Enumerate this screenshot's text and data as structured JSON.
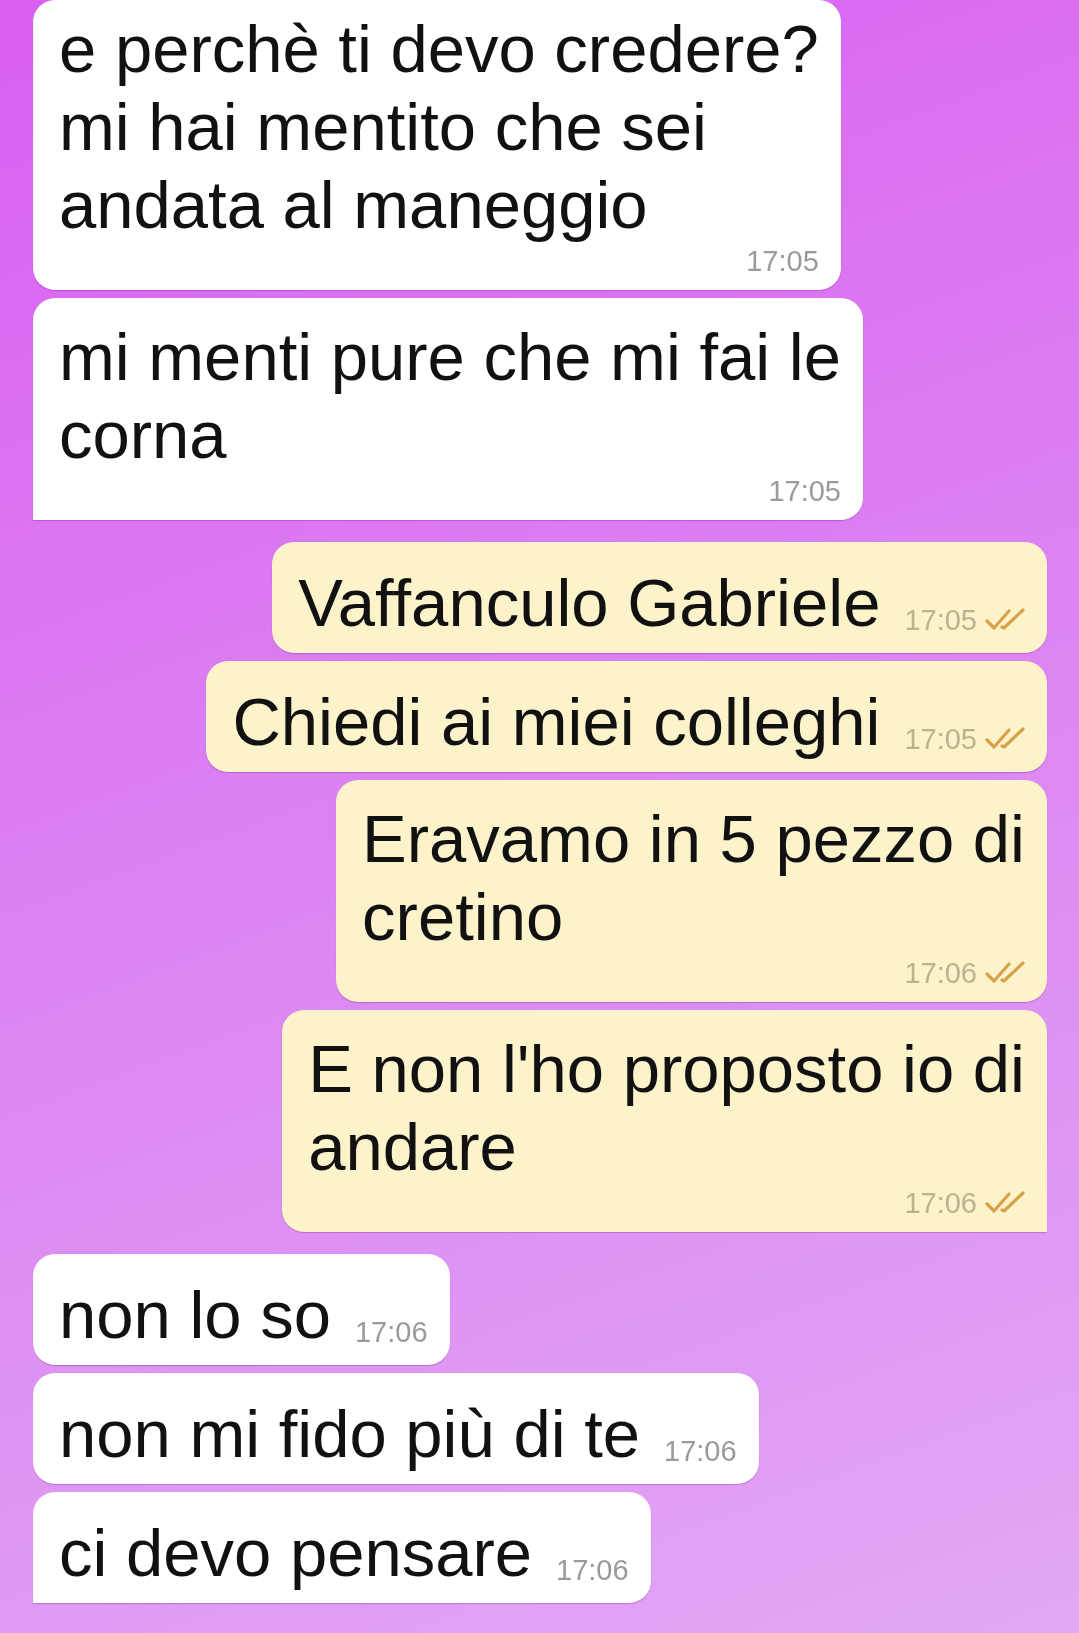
{
  "messages": [
    {
      "kind": "in",
      "lines": [
        "e perchè ti devo credere?",
        "mi hai mentito che sei",
        "andata al maneggio"
      ],
      "time": "17:05",
      "tail": false
    },
    {
      "kind": "in",
      "lines": [
        "mi menti pure che mi fai le",
        "corna"
      ],
      "time": "17:05",
      "tail": true
    },
    {
      "kind": "out",
      "lines": [
        "Vaffanculo Gabriele"
      ],
      "time": "17:05",
      "read": true,
      "tail": false
    },
    {
      "kind": "out",
      "lines": [
        "Chiedi ai miei colleghi"
      ],
      "time": "17:05",
      "read": true,
      "tail": false
    },
    {
      "kind": "out",
      "lines": [
        "Eravamo in 5 pezzo di",
        "cretino"
      ],
      "time": "17:06",
      "read": true,
      "tail": false
    },
    {
      "kind": "out",
      "lines": [
        "E non l'ho proposto io di",
        "andare"
      ],
      "time": "17:06",
      "read": true,
      "tail": true
    },
    {
      "kind": "in",
      "lines": [
        "non lo so"
      ],
      "time": "17:06",
      "tail": false
    },
    {
      "kind": "in",
      "lines": [
        "non mi fido più di te"
      ],
      "time": "17:06",
      "tail": false
    },
    {
      "kind": "in",
      "lines": [
        "ci devo pensare"
      ],
      "time": "17:06",
      "tail": true
    }
  ]
}
